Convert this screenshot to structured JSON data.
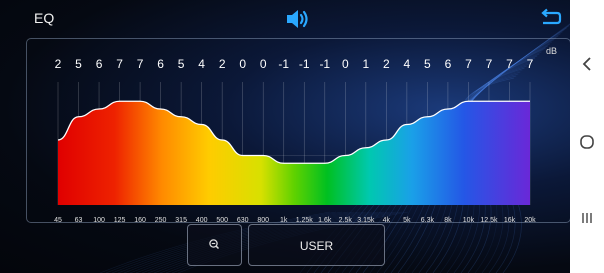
{
  "header": {
    "title": "EQ",
    "icons": {
      "center": "speaker-volume-icon",
      "right": "return-arrow-icon"
    },
    "accent": "#2aa8ff"
  },
  "chart_data": {
    "type": "area",
    "title": "",
    "xlabel": "",
    "ylabel": "dB",
    "categories": [
      "45",
      "63",
      "100",
      "125",
      "160",
      "250",
      "315",
      "400",
      "500",
      "630",
      "800",
      "1k",
      "1.25k",
      "1.6k",
      "2.5k",
      "3.15k",
      "4k",
      "5k",
      "6.3k",
      "8k",
      "10k",
      "12.5k",
      "16k",
      "20k"
    ],
    "series": [
      {
        "values": [
          2,
          5,
          6,
          7,
          7,
          6,
          5,
          4,
          2,
          0,
          0,
          -1,
          -1,
          -1,
          0,
          1,
          2,
          4,
          5,
          6,
          7,
          7,
          7,
          7
        ]
      }
    ],
    "ylim": [
      -7,
      10
    ],
    "grid": true
  },
  "controls": {
    "zoom_icon": "zoom-out-icon",
    "preset_label": "USER"
  },
  "system_nav": {
    "icons": [
      "back-chevron-icon",
      "home-circle-icon",
      "recents-icon"
    ]
  }
}
